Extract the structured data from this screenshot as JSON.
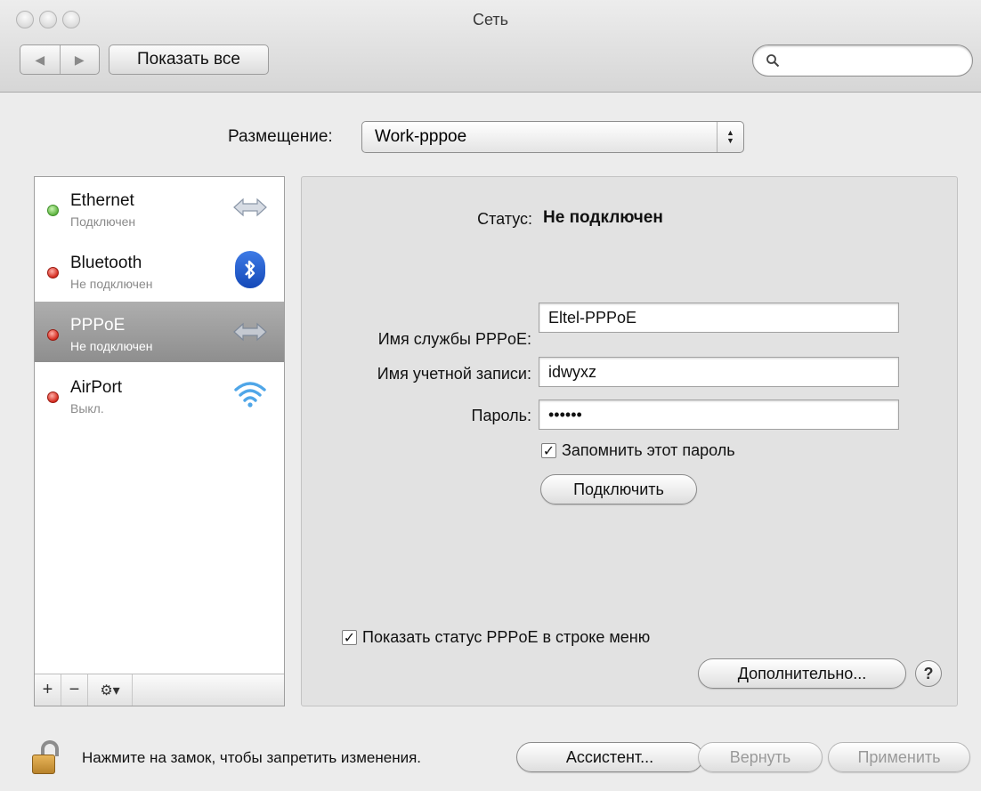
{
  "window": {
    "title": "Сеть"
  },
  "toolbar": {
    "back_glyph": "◀",
    "forward_glyph": "▶",
    "show_all_label": "Показать все",
    "search": {
      "value": "",
      "placeholder": ""
    }
  },
  "location": {
    "label": "Размещение:",
    "value": "Work-pppoe"
  },
  "services": [
    {
      "name": "Ethernet",
      "status": "Подключен",
      "status_color": "green",
      "icon": "ethernet-arrows-icon"
    },
    {
      "name": "Bluetooth",
      "status": "Не подключен",
      "status_color": "red",
      "icon": "bluetooth-icon"
    },
    {
      "name": "PPPoE",
      "status": "Не подключен",
      "status_color": "red",
      "icon": "pppoe-arrows-icon",
      "selected": true
    },
    {
      "name": "AirPort",
      "status": "Выкл.",
      "status_color": "red",
      "icon": "airport-wifi-icon"
    }
  ],
  "list_controls": {
    "add": "+",
    "remove": "−",
    "action": "⚙▾"
  },
  "detail": {
    "status_label": "Статус:",
    "status_value": "Не подключен",
    "service_name_label": "Имя службы PPPoE:",
    "service_name_value": "Eltel-PPPoE",
    "account_label": "Имя учетной записи:",
    "account_value": "idwyxz",
    "password_label": "Пароль:",
    "password_value": "••••••",
    "remember_label": "Запомнить этот пароль",
    "remember_checked": true,
    "connect_label": "Подключить",
    "show_status_label": "Показать статус PPPoE в строке меню",
    "show_status_checked": true,
    "advanced_label": "Дополнительно...",
    "help_label": "?"
  },
  "bottom": {
    "lock_text": "Нажмите на замок, чтобы запретить изменения.",
    "assistant_label": "Ассистент...",
    "revert_label": "Вернуть",
    "apply_label": "Применить"
  },
  "colors": {
    "status_green": "#5fb341",
    "status_red": "#d42b1f",
    "selection": "#9e9e9e"
  }
}
